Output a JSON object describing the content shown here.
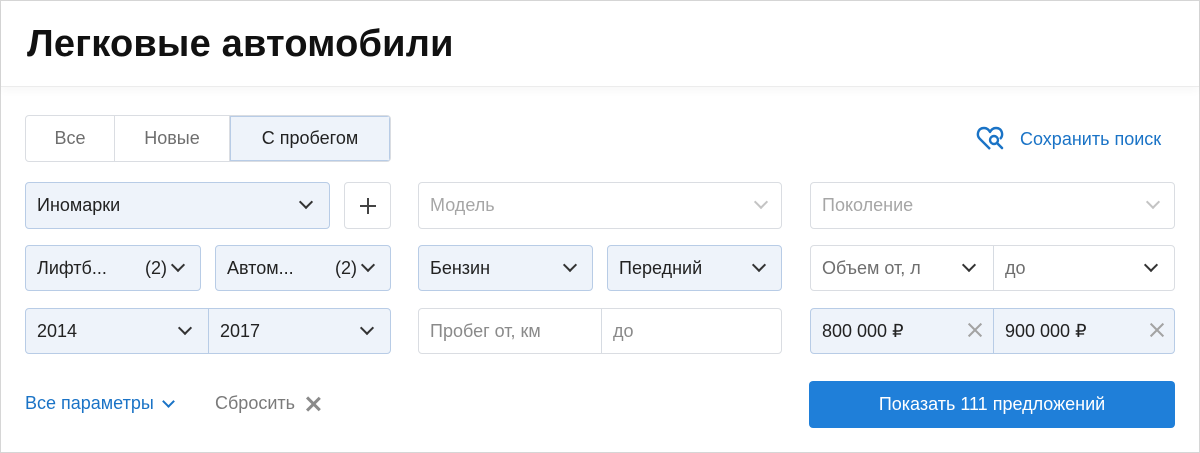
{
  "header": {
    "title": "Легковые автомобили"
  },
  "tabs": [
    {
      "label": "Все"
    },
    {
      "label": "Новые"
    },
    {
      "label": "С пробегом"
    }
  ],
  "save_search": {
    "label": "Сохранить поиск",
    "icon": "heart-search-icon"
  },
  "filters": {
    "origin": {
      "value": "Иномарки"
    },
    "model": {
      "placeholder": "Модель"
    },
    "generation": {
      "placeholder": "Поколение"
    },
    "body": {
      "value": "Лифтб...",
      "count": "(2)"
    },
    "transmission": {
      "value": "Автом...",
      "count": "(2)"
    },
    "fuel": {
      "value": "Бензин"
    },
    "drive": {
      "value": "Передний"
    },
    "volume_from": {
      "placeholder": "Объем от, л"
    },
    "volume_to": {
      "placeholder": "до"
    },
    "year_from": {
      "value": "2014"
    },
    "year_to": {
      "value": "2017"
    },
    "mileage_from": {
      "placeholder": "Пробег от, км"
    },
    "mileage_to": {
      "placeholder": "до"
    },
    "price_from": {
      "value": "800 000 ₽"
    },
    "price_to": {
      "value": "900 000 ₽"
    }
  },
  "footer": {
    "all_params": "Все параметры",
    "reset": "Сбросить",
    "submit": "Показать 111 предложений"
  },
  "colors": {
    "accent": "#1f7fd9",
    "link": "#1a73c6",
    "selected_bg": "#eef3fa"
  }
}
